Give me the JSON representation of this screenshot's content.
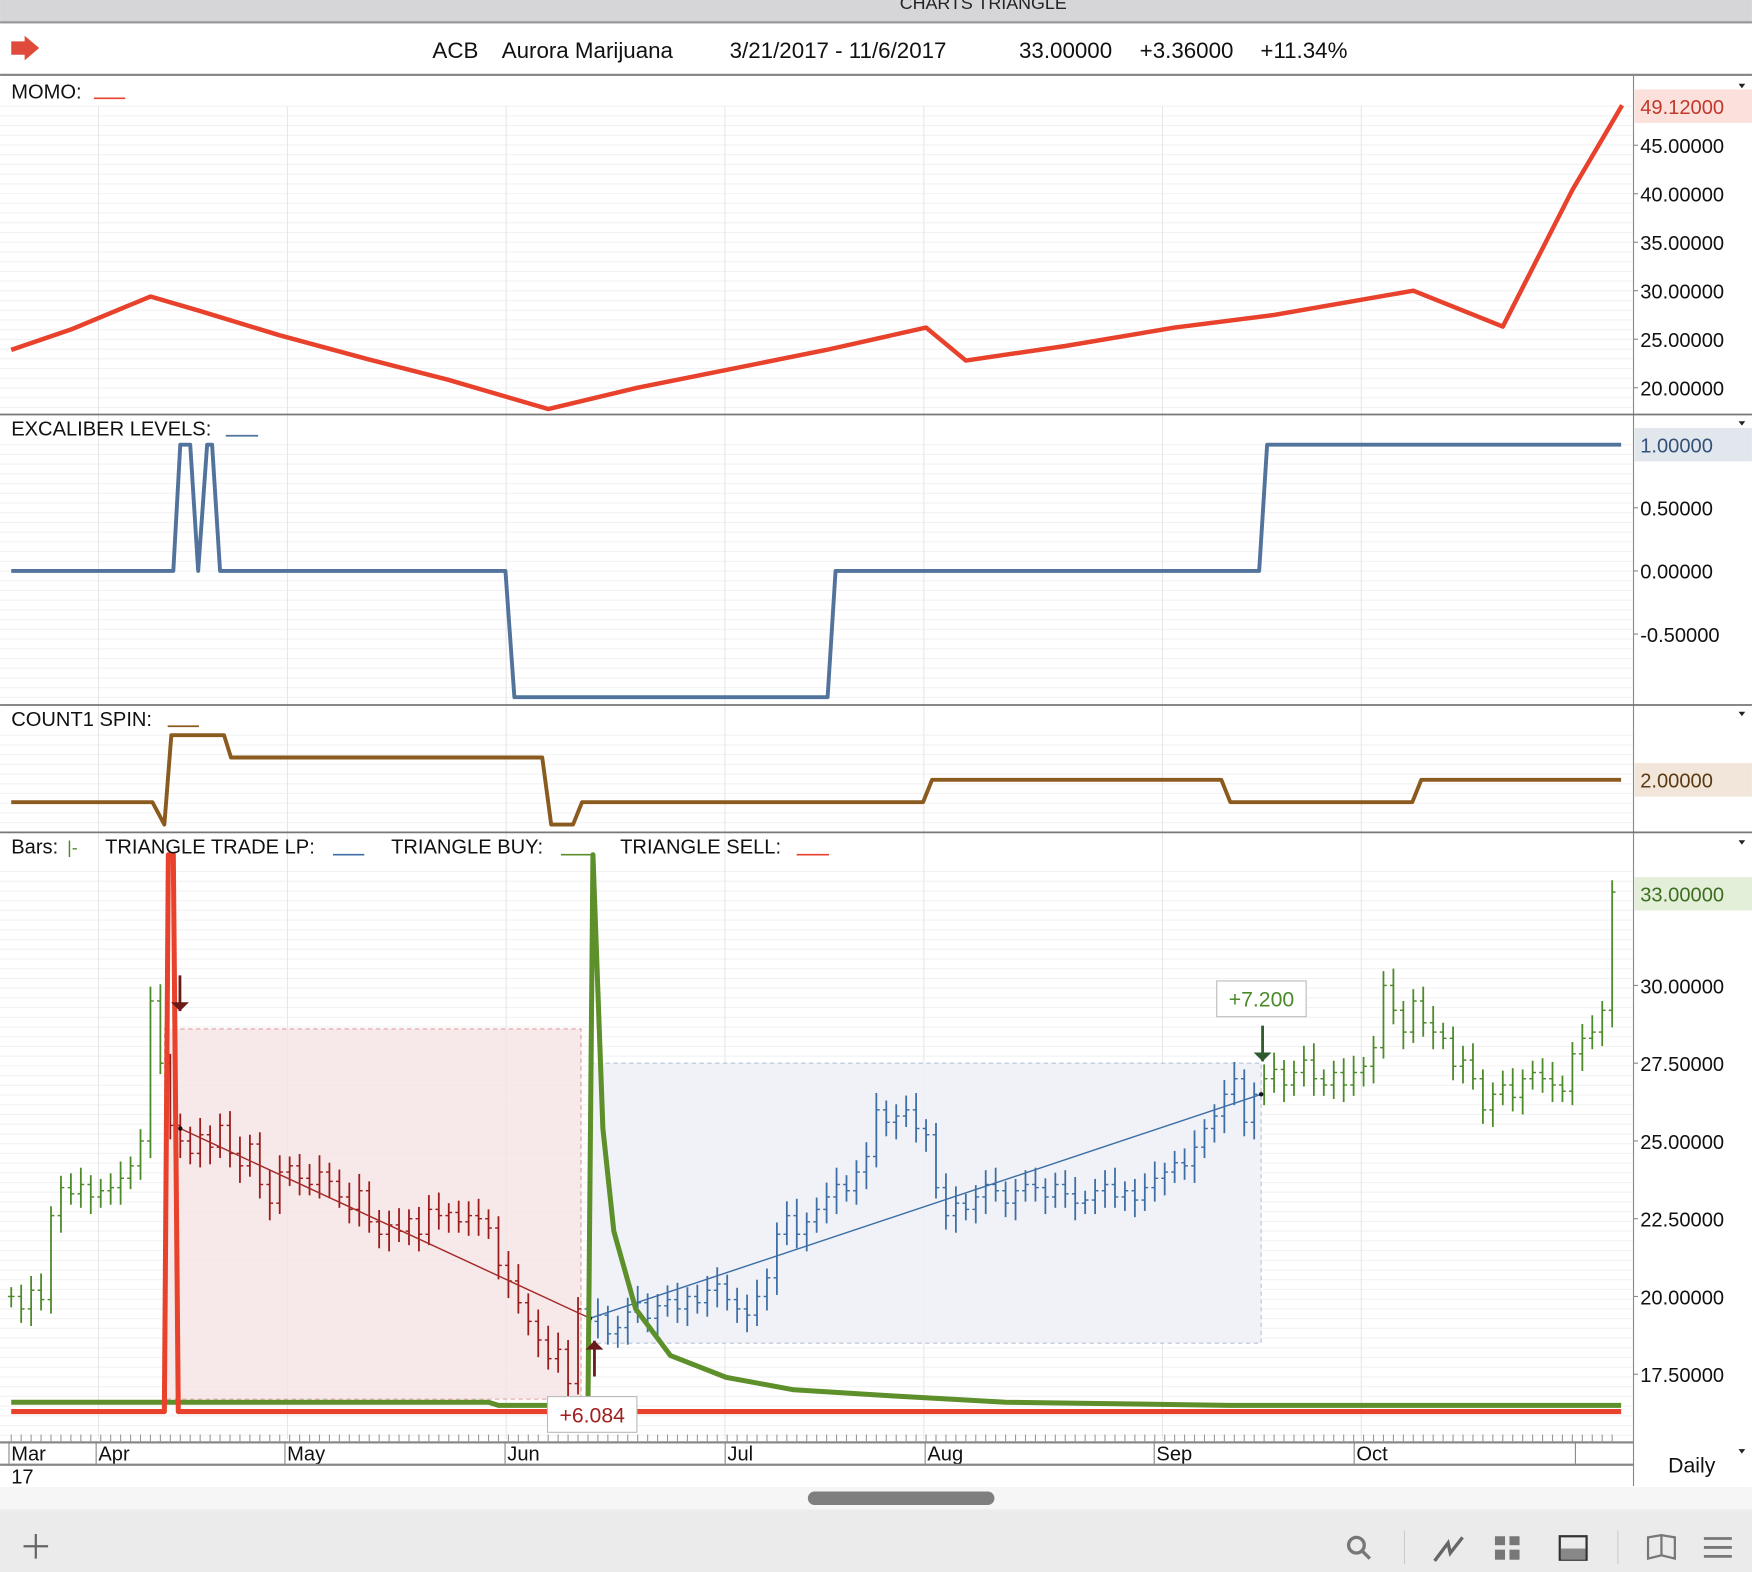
{
  "window": {
    "title": "CHARTS TRIANGLE"
  },
  "header": {
    "symbol": "ACB",
    "name": "Aurora Marijuana",
    "date_range": "3/21/2017 - 11/6/2017",
    "last": "33.00000",
    "change": "+3.36000",
    "change_pct": "+11.34%",
    "arrow_icon": "right-arrow-icon"
  },
  "panels": {
    "momo": {
      "label": "MOMO:",
      "color": "#e8412c",
      "tag": "49.12000",
      "ticks": [
        "45.00000",
        "40.00000",
        "35.00000",
        "30.00000",
        "25.00000",
        "20.00000"
      ]
    },
    "excaliber": {
      "label": "EXCALIBER LEVELS:",
      "color": "#52739c",
      "tag": "1.00000",
      "ticks": [
        "0.50000",
        "0.00000",
        "-0.50000"
      ]
    },
    "count1": {
      "label": "COUNT1 SPIN:",
      "color": "#8b5a1e",
      "tag": "2.00000"
    },
    "price": {
      "bars_label": "Bars:",
      "lp_label": "TRIANGLE TRADE LP:",
      "buy_label": "TRIANGLE BUY:",
      "sell_label": "TRIANGLE SELL:",
      "tag": "33.00000",
      "ticks": [
        "30.00000",
        "27.50000",
        "25.00000",
        "22.50000",
        "20.00000",
        "17.50000"
      ],
      "sell_annotation": "+6.084",
      "buy_annotation": "+7.200"
    }
  },
  "xaxis": {
    "months": [
      "Mar",
      "Apr",
      "May",
      "Jun",
      "Jul",
      "Aug",
      "Sep",
      "Oct"
    ],
    "year": "17",
    "period": "Daily"
  },
  "toolbar": {
    "icons": [
      "plus-icon",
      "search-icon",
      "line-chart-icon",
      "grid-icon",
      "panel-icon",
      "book-icon",
      "menu-icon"
    ]
  },
  "colors": {
    "up": "#4d8a2a",
    "down_trade": "#9b1c1c",
    "long_trade": "#3d6fa6",
    "sell": "#e8412c",
    "buy": "#5d8f2a"
  },
  "chart_data": {
    "type": "line",
    "x_unit": "trading day index from 3/21/2017",
    "month_start_days": [
      0,
      9,
      28,
      50,
      72,
      92,
      116,
      136
    ],
    "momo": {
      "ylim": [
        17,
        50
      ],
      "points": [
        [
          0,
          23.9
        ],
        [
          6,
          26.0
        ],
        [
          14,
          29.4
        ],
        [
          19,
          27.9
        ],
        [
          27,
          25.4
        ],
        [
          36,
          22.9
        ],
        [
          44,
          20.8
        ],
        [
          54,
          17.8
        ],
        [
          63,
          20.0
        ],
        [
          82,
          23.9
        ],
        [
          92,
          26.2
        ],
        [
          96,
          22.8
        ],
        [
          106,
          24.3
        ],
        [
          117,
          26.2
        ],
        [
          127,
          27.5
        ],
        [
          141,
          30.0
        ],
        [
          150,
          26.3
        ],
        [
          157,
          40.4
        ],
        [
          162,
          49.12
        ]
      ]
    },
    "excaliber": {
      "ylim": [
        -1.1,
        1.2
      ],
      "points": [
        [
          0,
          0
        ],
        [
          16.3,
          0
        ],
        [
          17,
          1
        ],
        [
          18,
          1
        ],
        [
          18.8,
          0
        ],
        [
          19.7,
          1
        ],
        [
          20.2,
          1
        ],
        [
          21,
          0
        ],
        [
          49.7,
          0
        ],
        [
          50.6,
          -1
        ],
        [
          82.1,
          -1
        ],
        [
          82.9,
          0
        ],
        [
          125.5,
          0
        ],
        [
          126.3,
          1
        ],
        [
          161.9,
          1
        ]
      ]
    },
    "count1": {
      "ylim": [
        -0.2,
        4.5
      ],
      "points": [
        [
          0,
          1
        ],
        [
          14.2,
          1
        ],
        [
          15.4,
          0
        ],
        [
          16.1,
          4
        ],
        [
          21.4,
          4
        ],
        [
          22.1,
          3
        ],
        [
          53.4,
          3
        ],
        [
          54.3,
          0
        ],
        [
          56.5,
          0
        ],
        [
          57.4,
          1
        ],
        [
          91.7,
          1
        ],
        [
          92.6,
          2
        ],
        [
          121.7,
          2
        ],
        [
          122.6,
          1
        ],
        [
          140.9,
          1
        ],
        [
          141.8,
          2
        ],
        [
          161.9,
          2
        ]
      ]
    },
    "price": {
      "ylim": [
        16.0,
        34.5
      ],
      "closes": [
        20.0,
        19.6,
        20.2,
        19.9,
        22.6,
        23.5,
        23.3,
        23.6,
        23.2,
        23.4,
        23.5,
        23.8,
        24.2,
        25.0,
        29.5,
        27.5,
        25.5,
        25.0,
        24.6,
        25.2,
        24.8,
        25.5,
        24.6,
        24.2,
        24.9,
        23.6,
        23.0,
        24.0,
        24.2,
        23.8,
        23.6,
        24.0,
        23.7,
        23.2,
        22.8,
        23.4,
        22.4,
        22.0,
        22.3,
        22.1,
        22.5,
        22.0,
        22.8,
        22.6,
        22.7,
        22.4,
        22.6,
        22.5,
        22.2,
        21.0,
        20.5,
        19.8,
        19.2,
        18.6,
        18.0,
        18.3,
        17.2,
        19.6,
        19.2,
        19.4,
        18.8,
        19.0,
        19.5,
        19.8,
        19.3,
        19.7,
        19.9,
        19.6,
        20.0,
        19.8,
        20.2,
        20.4,
        19.9,
        19.6,
        19.4,
        20.0,
        20.6,
        22.0,
        22.6,
        22.0,
        22.4,
        22.8,
        23.2,
        23.6,
        23.4,
        24.0,
        24.5,
        26.0,
        25.6,
        25.8,
        26.0,
        25.4,
        25.2,
        23.5,
        22.6,
        23.0,
        22.8,
        23.2,
        23.6,
        23.4,
        23.0,
        23.4,
        23.6,
        23.5,
        23.2,
        23.6,
        23.3,
        23.0,
        23.1,
        23.4,
        23.6,
        23.2,
        23.4,
        23.1,
        23.5,
        23.8,
        24.0,
        24.3,
        24.2,
        24.8,
        25.4,
        25.8,
        26.5,
        27.0,
        25.6,
        26.5,
        27.0,
        27.3,
        26.8,
        27.2,
        27.6,
        27.0,
        26.8,
        27.2,
        26.8,
        27.2,
        27.4,
        28.0,
        30.0,
        29.2,
        28.5,
        29.5,
        28.8,
        28.5,
        28.3,
        27.4,
        27.6,
        27.0,
        26.0,
        26.5,
        26.8,
        26.4,
        27.0,
        27.2,
        27.0,
        26.8,
        26.6,
        27.8,
        28.3,
        28.5,
        29.2,
        33.0
      ],
      "short_trade": {
        "entry_day": 17,
        "entry": 25.4,
        "exit_day": 58.2,
        "exit": 19.3,
        "box": [
          28.6,
          16.7
        ],
        "result": 6.084
      },
      "long_trade": {
        "entry_day": 58.2,
        "entry": 19.3,
        "exit_day": 125.7,
        "exit": 26.5,
        "box": [
          27.5,
          18.5
        ],
        "result": 7.2
      },
      "triangle_sell": {
        "spike_day": 16
      },
      "triangle_buy": {
        "spike_day": 58.5,
        "decay": [
          [
            59.5,
            25.4
          ],
          [
            60.6,
            22.1
          ],
          [
            62.8,
            19.6
          ],
          [
            66.3,
            18.1
          ],
          [
            71.9,
            17.4
          ],
          [
            78.7,
            17.0
          ],
          [
            88.8,
            16.8
          ],
          [
            100,
            16.6
          ],
          [
            122.5,
            16.5
          ],
          [
            161.9,
            16.5
          ]
        ]
      }
    }
  }
}
